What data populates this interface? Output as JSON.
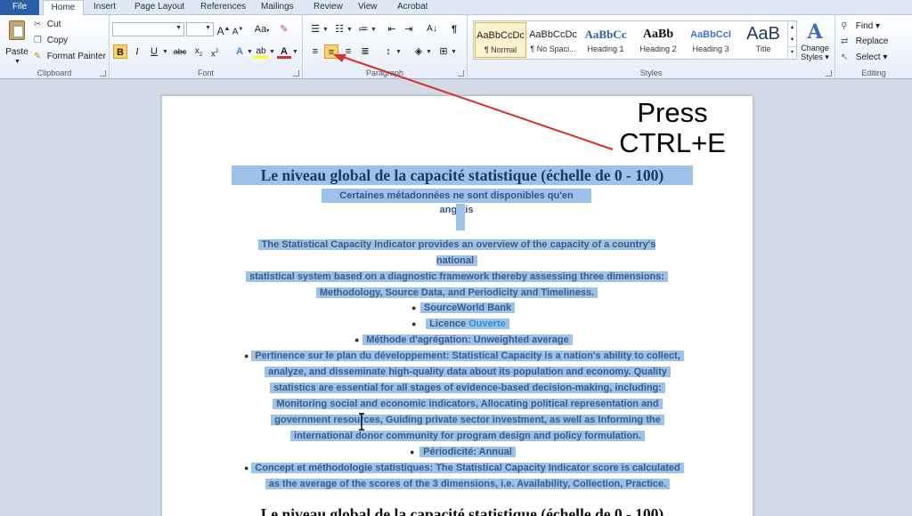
{
  "tabs": [
    "File",
    "Home",
    "Insert",
    "Page Layout",
    "References",
    "Mailings",
    "Review",
    "View",
    "Acrobat"
  ],
  "clipboard": {
    "paste_label": "Paste",
    "cut_label": "Cut",
    "copy_label": "Copy",
    "format_painter_label": "Format Painter",
    "group_label": "Clipboard"
  },
  "font": {
    "font_name": "",
    "font_size": "",
    "group_label": "Font"
  },
  "paragraph": {
    "group_label": "Paragraph",
    "active_button": "center"
  },
  "styles": {
    "group_label": "Styles",
    "tiles": [
      {
        "sample": "AaBbCcDc",
        "name": "¶ Normal"
      },
      {
        "sample": "AaBbCcDc",
        "name": "¶ No Spaci..."
      },
      {
        "sample": "AaBbCс",
        "name": "Heading 1"
      },
      {
        "sample": "AaBb",
        "name": "Heading 2"
      },
      {
        "sample": "AaBbCcI",
        "name": "Heading 3"
      },
      {
        "sample": "AaB",
        "name": "Title"
      }
    ],
    "change_styles_line1": "Change",
    "change_styles_line2": "Styles ▾"
  },
  "editing": {
    "group_label": "Editing",
    "find_label": "Find ▾",
    "replace_label": "Replace",
    "select_label": "Select ▾"
  },
  "annotation": {
    "line1": "Press",
    "line2": "CTRL+E"
  },
  "document": {
    "title": "Le niveau global de la capacité statistique (échelle de 0 - 100)",
    "subtitle": "Certaines  métadonnées  ne sont disponibles qu'en anglais",
    "paragraph_lines": [
      "The Statistical Capacity Indicator provides an overview of the capacity of a country's  national",
      "statistical system based on a diagnostic framework thereby assessing three dimensions:",
      "Methodology, Source Data, and Periodicity and Timeliness."
    ],
    "bullet_lines": [
      "SourceWorld  Bank",
      "Licence ",
      "Méthode d'agrégation: Unweighted average",
      "Pertinence  sur le plan du développement:  Statistical  Capacity  is a nation's ability to collect,",
      "analyze, and disseminate high-quality data about its population and economy. Quality",
      "statistics  are essential  for all stages of evidence-based  decision-making,  including:",
      "Monitoring social and economic indicators, Allocating political representation  and",
      "government resources, Guiding private sector investment, as well as Informing the",
      "international  donor community for program design and policy formulation.",
      "Périodicité: Annual",
      "Concept et méthodologie statistiques: The Statistical Capacity Indicator score is calculated",
      "as the average of the scores of the 3 dimensions, i.e. Availability, Collection, Practice."
    ],
    "licence_link": "Ouverte",
    "next_title": "Le niveau global de la capacité statistique (échelle de 0 - 100)"
  },
  "colors": {
    "selection_highlight": "#9cc2e7",
    "arrow": "#d9302b",
    "file_tab": "#2a5fa8"
  }
}
